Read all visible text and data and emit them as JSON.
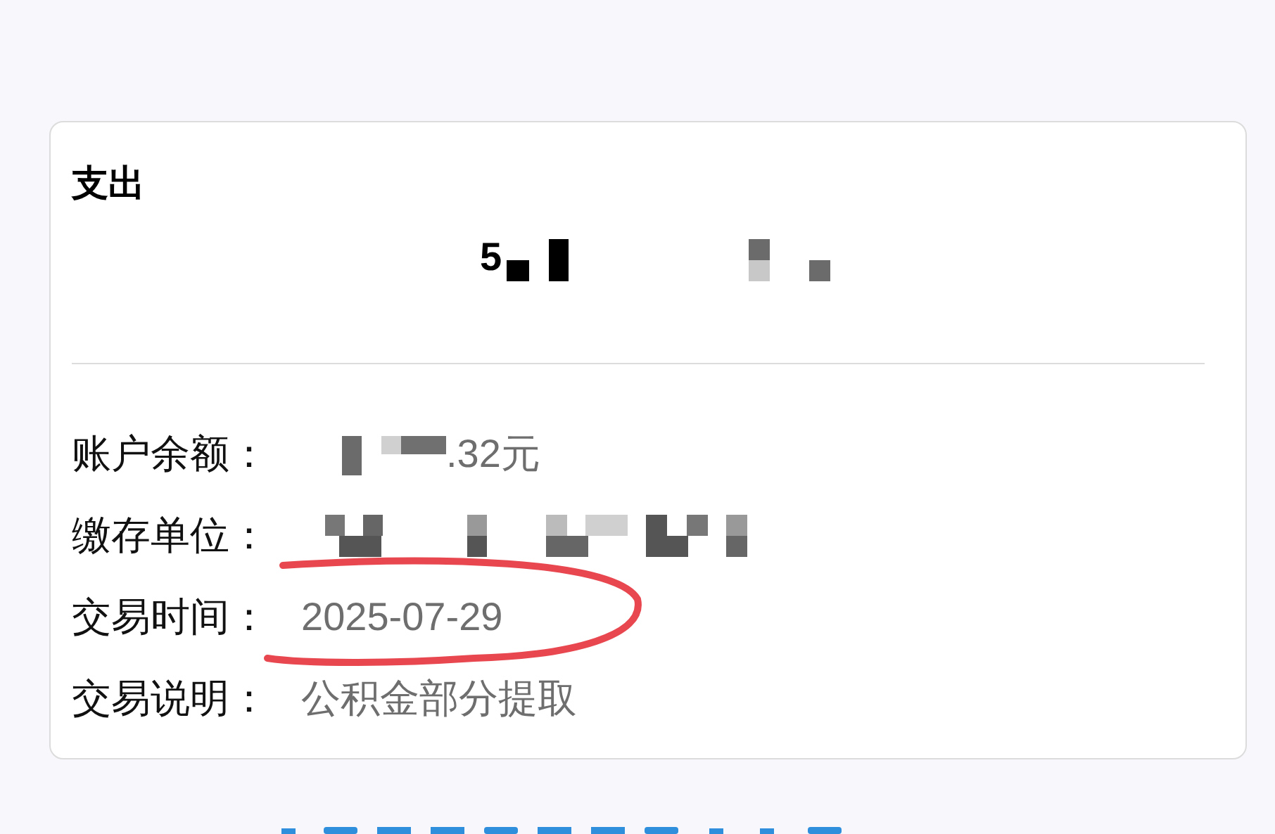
{
  "card": {
    "title": "支出",
    "amount": {
      "text": "5",
      "redacted": true
    },
    "fields": [
      {
        "label": "账户余额：",
        "value": ".32元",
        "redacted": true,
        "circled": false
      },
      {
        "label": "缴存单位：",
        "redacted": true,
        "circled": false
      },
      {
        "label": "交易时间：",
        "value": "2025-07-29",
        "redacted": false,
        "circled": true
      },
      {
        "label": "交易说明：",
        "value": "公积金部分提取",
        "redacted": false,
        "circled": false
      }
    ]
  }
}
